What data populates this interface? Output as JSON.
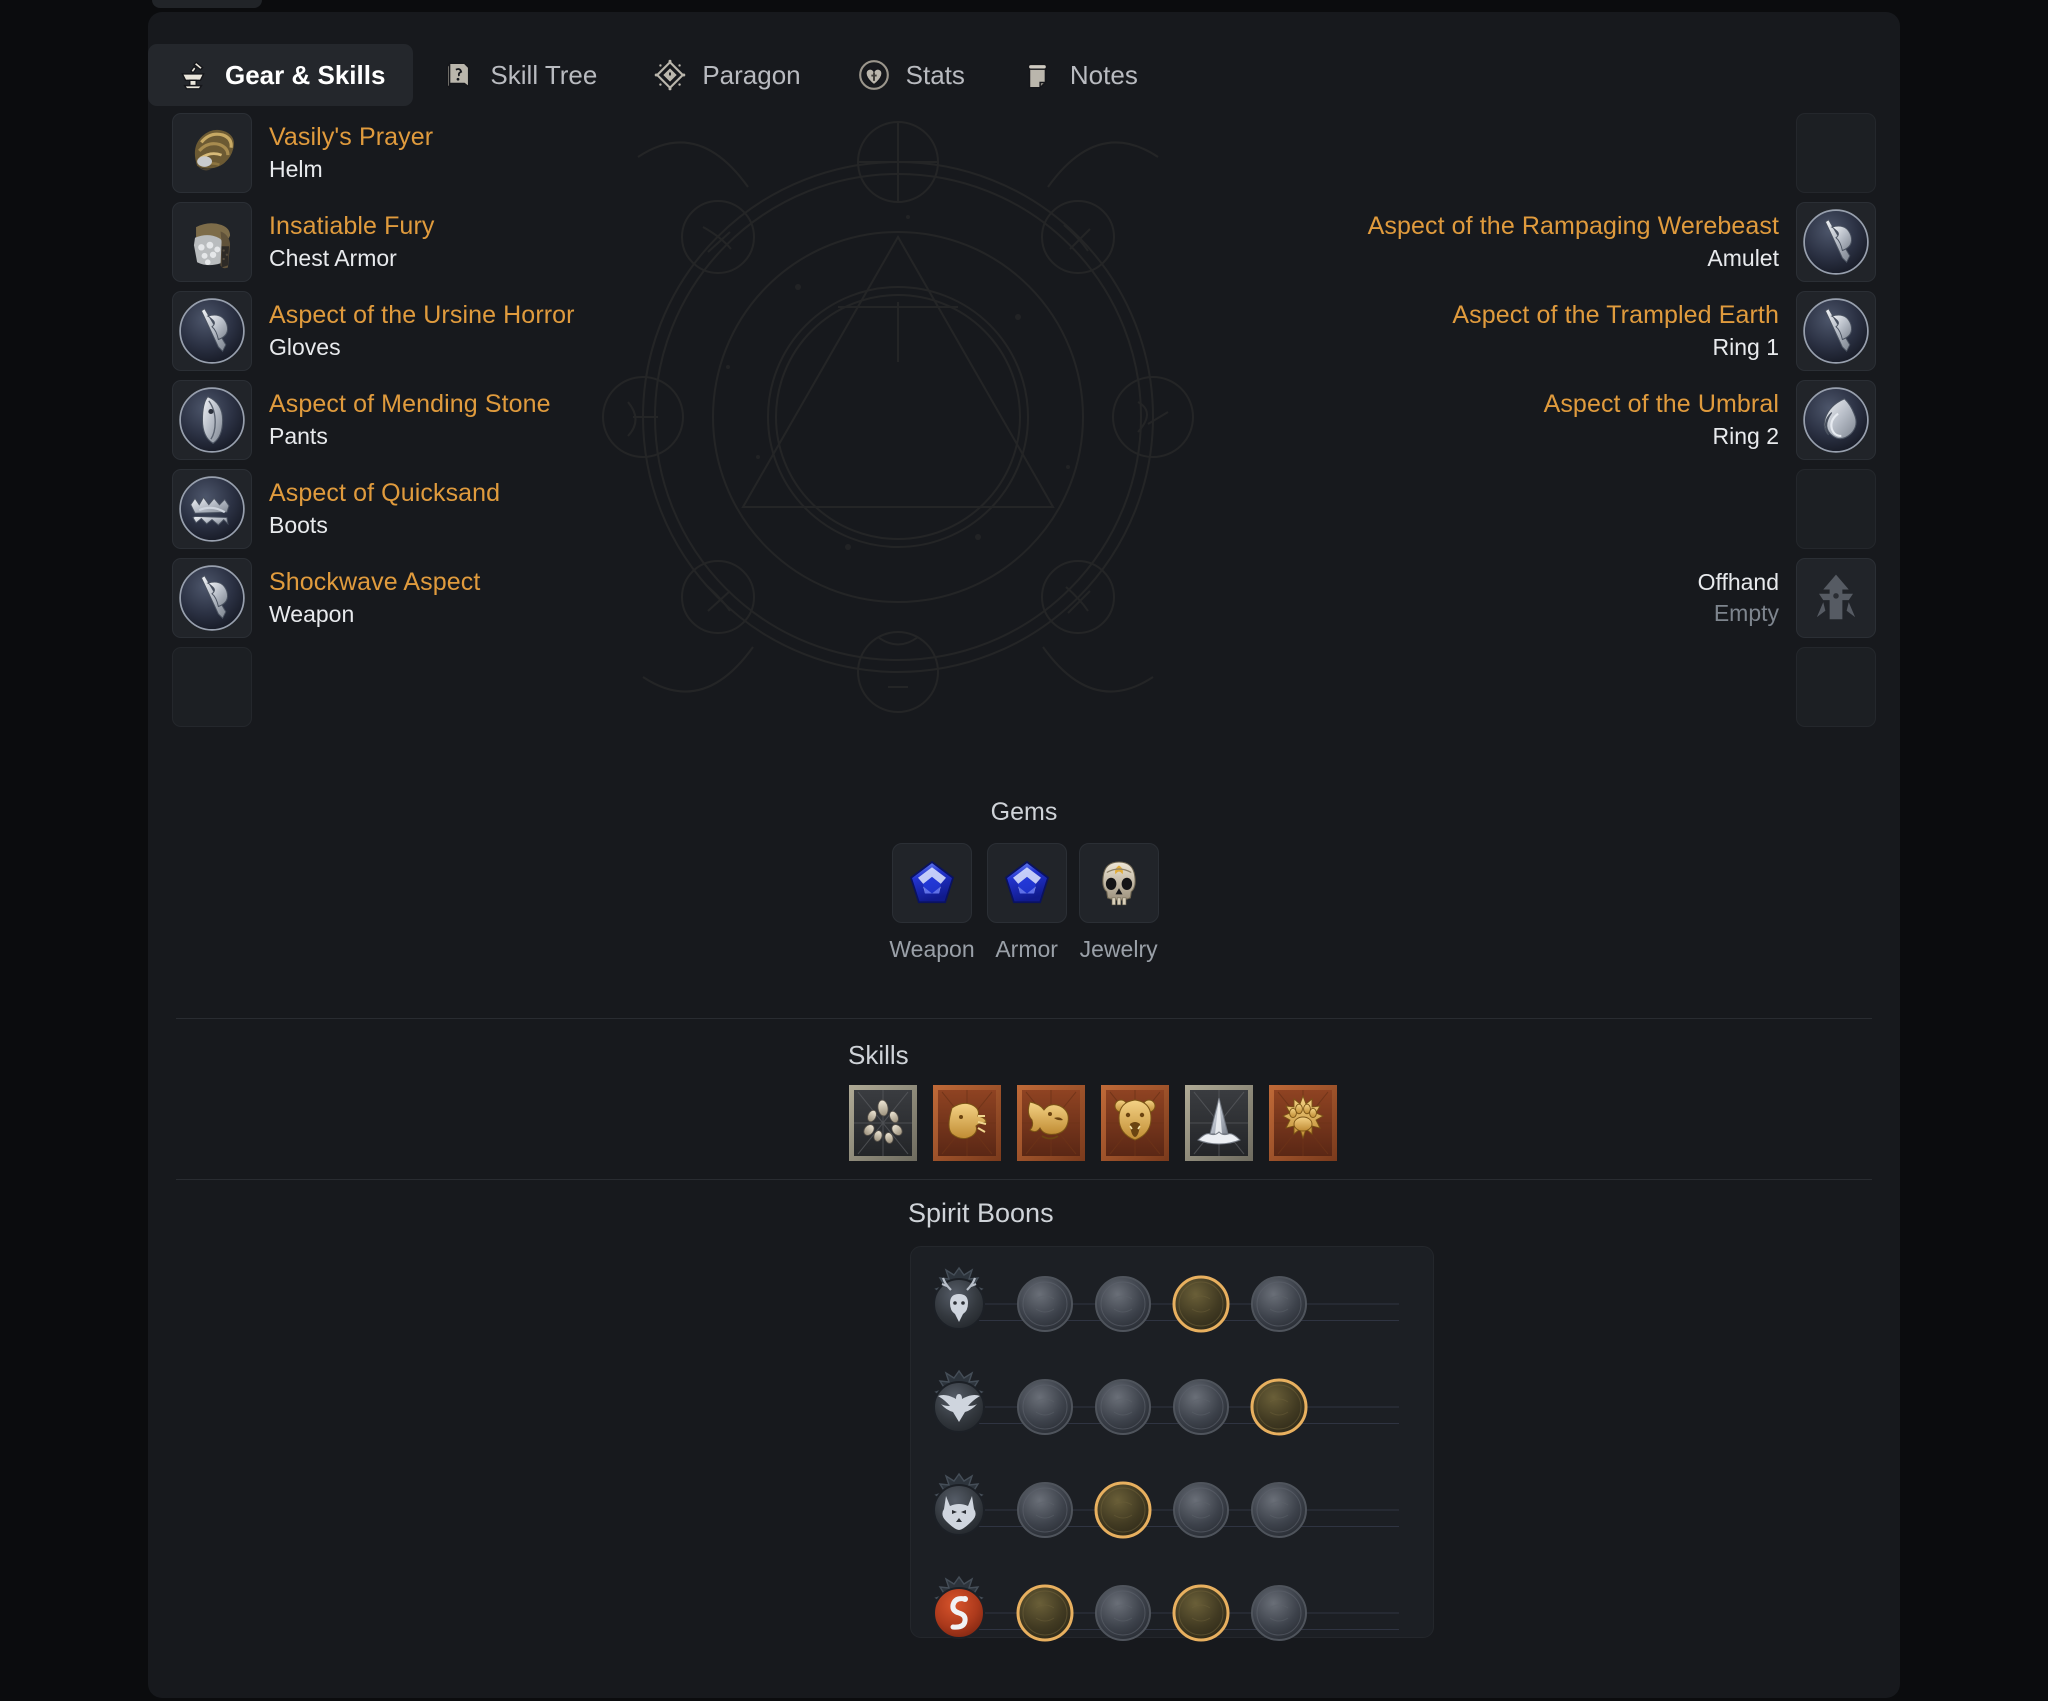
{
  "tabs": [
    {
      "label": "Gear & Skills",
      "icon": "anvil-icon",
      "active": true
    },
    {
      "label": "Skill Tree",
      "icon": "book-icon",
      "active": false
    },
    {
      "label": "Paragon",
      "icon": "diamond-icon",
      "active": false
    },
    {
      "label": "Stats",
      "icon": "heart-icon",
      "active": false
    },
    {
      "label": "Notes",
      "icon": "scroll-icon",
      "active": false
    }
  ],
  "colors": {
    "item_name": "#e09b3d",
    "slot_label": "#e8eaed",
    "muted": "#7e858e",
    "panel_bg": "#17191d",
    "slot_bg": "#212429",
    "boon_active": "#e0a857"
  },
  "gear": {
    "left": [
      {
        "name": "Vasily's Prayer",
        "slot": "Helm",
        "icon": "helm-item-icon",
        "empty": false
      },
      {
        "name": "Insatiable Fury",
        "slot": "Chest Armor",
        "icon": "chest-item-icon",
        "empty": false
      },
      {
        "name": "Aspect of the Ursine Horror",
        "slot": "Gloves",
        "icon": "aspect-axe-icon",
        "empty": false
      },
      {
        "name": "Aspect of Mending Stone",
        "slot": "Pants",
        "icon": "aspect-blade-icon",
        "empty": false
      },
      {
        "name": "Aspect of Quicksand",
        "slot": "Boots",
        "icon": "aspect-jaw-icon",
        "empty": false
      },
      {
        "name": "Shockwave Aspect",
        "slot": "Weapon",
        "icon": "aspect-axe-icon",
        "empty": false
      },
      {
        "name": "",
        "slot": "",
        "icon": "",
        "empty": true
      }
    ],
    "right": [
      {
        "name": "",
        "slot": "",
        "icon": "",
        "empty": true,
        "muted": false
      },
      {
        "name": "Aspect of the Rampaging Werebeast",
        "slot": "Amulet",
        "icon": "aspect-axe-icon",
        "empty": false,
        "muted": false
      },
      {
        "name": "Aspect of the Trampled Earth",
        "slot": "Ring 1",
        "icon": "aspect-axe-icon",
        "empty": false,
        "muted": false
      },
      {
        "name": "Aspect of the Umbral",
        "slot": "Ring 2",
        "icon": "aspect-flame-icon",
        "empty": false,
        "muted": false
      },
      {
        "name": "",
        "slot": "",
        "icon": "",
        "empty": true,
        "muted": false
      },
      {
        "name": "Offhand",
        "slot": "Empty",
        "icon": "totem-glyph-icon",
        "empty": false,
        "muted": true
      },
      {
        "name": "",
        "slot": "",
        "icon": "",
        "empty": true,
        "muted": false
      }
    ]
  },
  "gems": {
    "title": "Gems",
    "items": [
      {
        "label": "Weapon",
        "icon": "sapphire-gem-icon"
      },
      {
        "label": "Armor",
        "icon": "sapphire-gem-icon"
      },
      {
        "label": "Jewelry",
        "icon": "skull-gem-icon"
      }
    ]
  },
  "skills": {
    "title": "Skills",
    "items": [
      {
        "icon": "earth-stones-skill-icon",
        "frame": "stone"
      },
      {
        "icon": "wolf-bite-skill-icon",
        "frame": "fire"
      },
      {
        "icon": "wolf-howl-skill-icon",
        "frame": "fire"
      },
      {
        "icon": "bear-roar-skill-icon",
        "frame": "fire"
      },
      {
        "icon": "stone-spike-skill-icon",
        "frame": "stone"
      },
      {
        "icon": "bear-paw-skill-icon",
        "frame": "fire"
      }
    ]
  },
  "spirit_boons": {
    "title": "Spirit Boons",
    "rows": [
      {
        "spirit": "deer-spirit-icon",
        "spirit_tint": "dark",
        "nodes": [
          false,
          false,
          true,
          false
        ]
      },
      {
        "spirit": "eagle-spirit-icon",
        "spirit_tint": "dark",
        "nodes": [
          false,
          false,
          false,
          true
        ]
      },
      {
        "spirit": "wolf-spirit-icon",
        "spirit_tint": "dark",
        "nodes": [
          false,
          true,
          false,
          false
        ]
      },
      {
        "spirit": "snake-spirit-icon",
        "spirit_tint": "red",
        "nodes": [
          true,
          false,
          true,
          false
        ]
      }
    ]
  }
}
